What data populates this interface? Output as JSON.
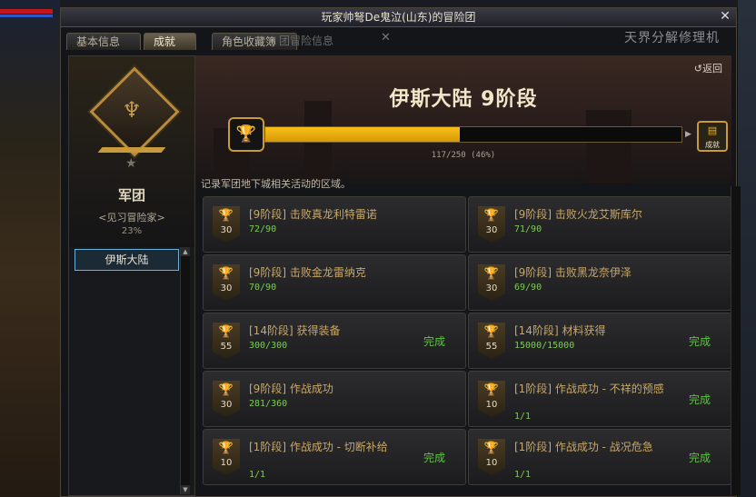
{
  "window": {
    "title": "玩家帅弩De鬼泣(山东)的冒险团"
  },
  "tabs": [
    {
      "label": "基本信息",
      "active": false
    },
    {
      "label": "成就",
      "active": true
    },
    {
      "label": "角色收藏簿",
      "active": false
    }
  ],
  "background_text": {
    "ghost_tab": "团冒险信息",
    "ghost_right": "天界分解修理机"
  },
  "rank": {
    "name": "军团",
    "title": "<见习冒险家>",
    "percent": "23%"
  },
  "region": {
    "label": "伊斯大陆"
  },
  "stage": {
    "title": "伊斯大陆 9阶段",
    "back_label": "返回",
    "progress_text": "117/250 (46%)",
    "progress_fraction": 0.468,
    "reward_label": "成就"
  },
  "description": "记录军团地下城相关活动的区域。",
  "achievements": [
    {
      "title": "[9阶段] 击败真龙利特雷诺",
      "progress": "72/90",
      "points": "30",
      "status": ""
    },
    {
      "title": "[9阶段] 击败火龙艾斯库尔",
      "progress": "71/90",
      "points": "30",
      "status": ""
    },
    {
      "title": "[9阶段] 击败金龙雷纳克",
      "progress": "70/90",
      "points": "30",
      "status": ""
    },
    {
      "title": "[9阶段] 击败黑龙奈伊泽",
      "progress": "69/90",
      "points": "30",
      "status": ""
    },
    {
      "title": "[14阶段] 获得装备",
      "progress": "300/300",
      "points": "55",
      "status": "完成"
    },
    {
      "title": "[14阶段] 材料获得",
      "progress": "15000/15000",
      "points": "55",
      "status": "完成"
    },
    {
      "title": "[9阶段] 作战成功",
      "progress": "281/360",
      "points": "30",
      "status": ""
    },
    {
      "title": "[1阶段] 作战成功 - 不祥的预感",
      "progress": "1/1",
      "points": "10",
      "status": "完成"
    },
    {
      "title": "[1阶段] 作战成功 - 切断补给",
      "progress": "1/1",
      "points": "10",
      "status": "完成"
    },
    {
      "title": "[1阶段] 作战成功 - 战况危急",
      "progress": "1/1",
      "points": "10",
      "status": "完成"
    }
  ],
  "colors": {
    "accent_gold": "#c89a3c",
    "progress_fill": "#f8c018",
    "complete_green": "#58c838",
    "progress_green": "#7ad050"
  },
  "icons": [
    "trophy-icon",
    "close-icon",
    "back-icon",
    "demon-emblem-icon",
    "star-icon"
  ]
}
